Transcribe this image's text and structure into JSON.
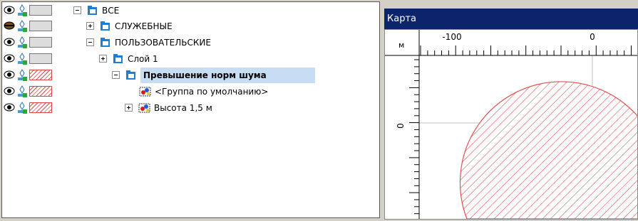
{
  "tree": {
    "rows": [
      {
        "label": "ВСЕ",
        "visibility": "visible",
        "layer_icon": "layer-icon",
        "swatch": "gray",
        "toggle": "expanded",
        "node_icon": "folder-icon",
        "bold": false,
        "selected": false
      },
      {
        "label": "СЛУЖЕБНЫЕ",
        "visibility": "hidden",
        "layer_icon": "layer-icon",
        "swatch": "gray",
        "toggle": "collapsed",
        "node_icon": "folder-icon",
        "bold": false,
        "selected": false
      },
      {
        "label": "ПОЛЬЗОВАТЕЛЬСКИЕ",
        "visibility": "visible",
        "layer_icon": "layer-icon",
        "swatch": "gray",
        "toggle": "expanded",
        "node_icon": "folder-icon",
        "bold": false,
        "selected": false
      },
      {
        "label": "Слой 1",
        "visibility": "visible",
        "layer_icon": "layer-icon",
        "swatch": "gray",
        "toggle": "collapsed",
        "node_icon": "folder-icon",
        "bold": false,
        "selected": false
      },
      {
        "label": "Превышение норм шума",
        "visibility": "visible",
        "layer_icon": "layer-icon",
        "swatch": "red-hatch",
        "toggle": "expanded",
        "node_icon": "folder-icon",
        "bold": true,
        "selected": true
      },
      {
        "label": "<Группа по умолчанию>",
        "visibility": "visible",
        "layer_icon": "layer-icon",
        "swatch": "red-hatch",
        "toggle": "none",
        "node_icon": "group-icon",
        "bold": false,
        "selected": false
      },
      {
        "label": "Высота 1,5 м",
        "visibility": "visible",
        "layer_icon": "layer-icon",
        "swatch": "red-hatch",
        "toggle": "collapsed",
        "node_icon": "group-icon",
        "bold": false,
        "selected": false
      }
    ]
  },
  "map": {
    "title": "Карта",
    "ruler_unit": "м",
    "x_ruler_labels": [
      "-100",
      "0"
    ],
    "y_ruler_labels": [
      "0"
    ],
    "colors": {
      "title_bar": "#0b246b",
      "hatch": "#e05050",
      "selection": "#c6ddf3"
    }
  }
}
